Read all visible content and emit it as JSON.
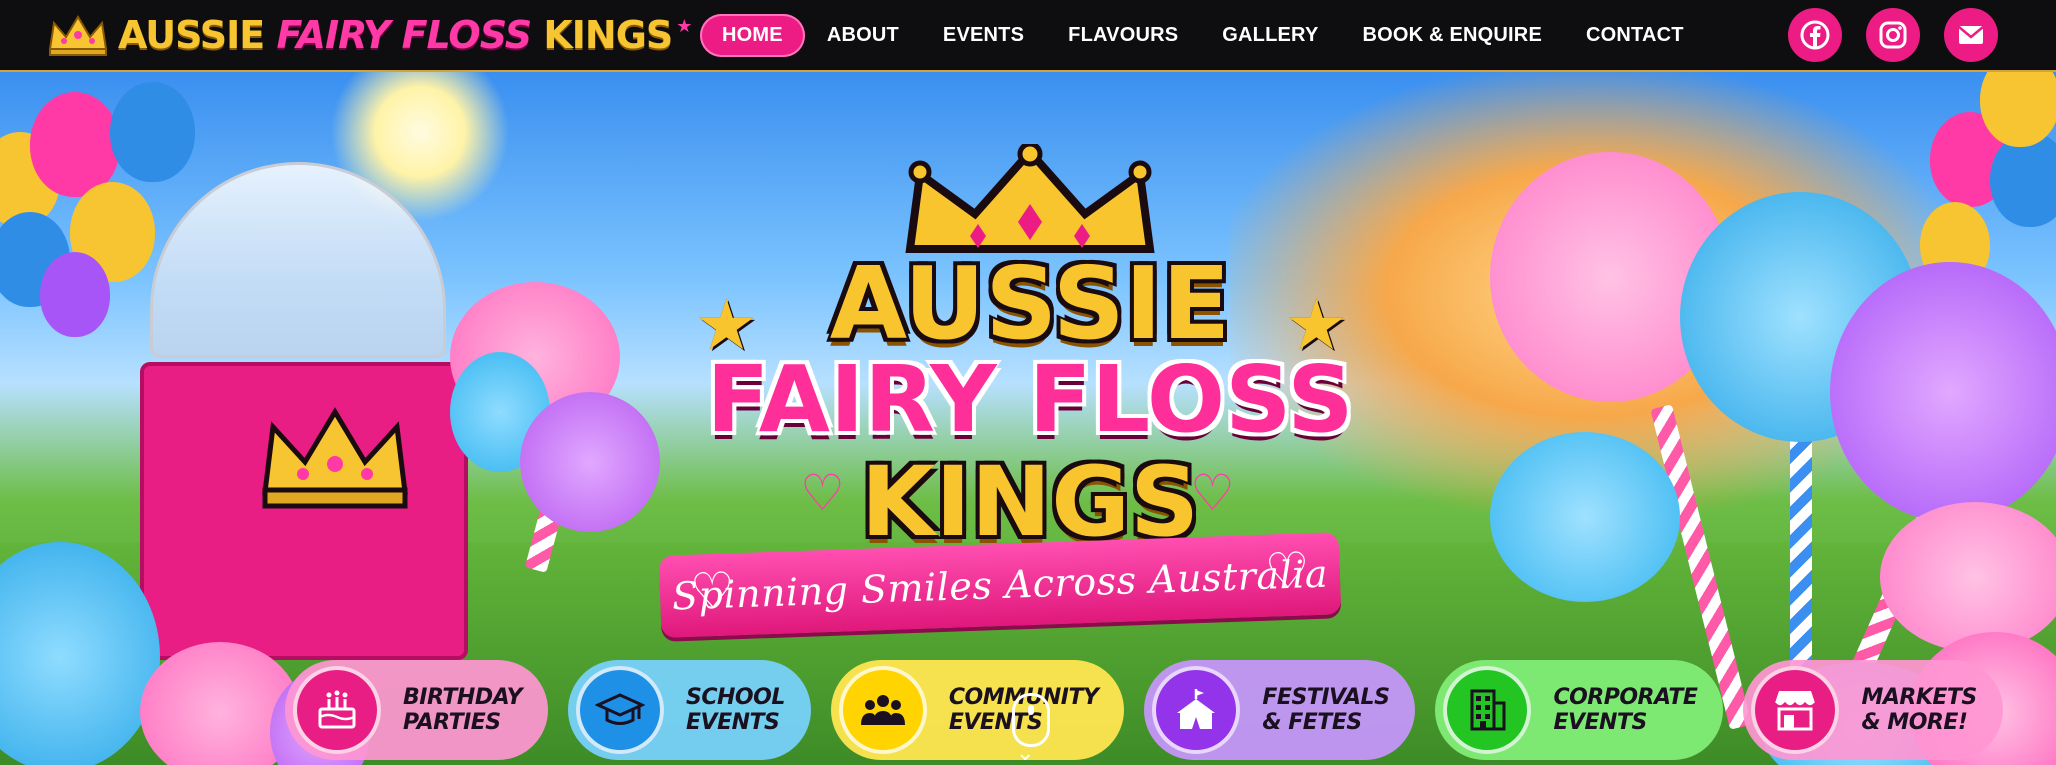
{
  "header": {
    "brand_part1": "AUSSIE",
    "brand_part2": "FAIRY FLOSS",
    "brand_part3": "KINGS",
    "nav": [
      {
        "label": "HOME",
        "active": true
      },
      {
        "label": "ABOUT",
        "active": false
      },
      {
        "label": "EVENTS",
        "active": false
      },
      {
        "label": "FLAVOURS",
        "active": false
      },
      {
        "label": "GALLERY",
        "active": false
      },
      {
        "label": "BOOK & ENQUIRE",
        "active": false
      },
      {
        "label": "CONTACT",
        "active": false
      }
    ],
    "socials": [
      "facebook-icon",
      "instagram-icon",
      "email-icon"
    ]
  },
  "hero": {
    "logo_line1": "AUSSIE",
    "logo_line2": "FAIRY FLOSS",
    "logo_line3": "KINGS",
    "tagline": "Spinning Smiles Across Australia",
    "events": [
      {
        "label": "BIRTHDAY\nPARTIES",
        "icon": "birthday-cake-icon",
        "color": "#ff4fb1"
      },
      {
        "label": "SCHOOL\nEVENTS",
        "icon": "graduation-cap-icon",
        "color": "#38b6ff"
      },
      {
        "label": "COMMUNITY\nEVENTS",
        "icon": "people-group-icon",
        "color": "#ffe01b"
      },
      {
        "label": "FESTIVALS\n& FETES",
        "icon": "circus-tent-icon",
        "color": "#a855f7"
      },
      {
        "label": "CORPORATE\nEVENTS",
        "icon": "office-building-icon",
        "color": "#4ade4a"
      },
      {
        "label": "MARKETS\n& MORE!",
        "icon": "market-stall-icon",
        "color": "#ff4fb1"
      }
    ]
  },
  "colors": {
    "accent": "#ec1c84",
    "gold": "#f8c52e",
    "nav_bg": "#0e0e10"
  }
}
